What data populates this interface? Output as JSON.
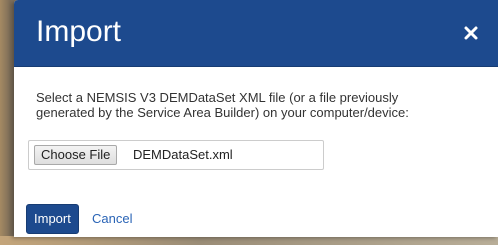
{
  "dialog": {
    "title": "Import",
    "close_icon": "close-icon",
    "instructions_line1": "Select a NEMSIS V3 DEMDataSet XML file (or a file previously",
    "instructions_line2": "generated by the Service Area Builder) on your computer/device:",
    "file_input": {
      "button_label": "Choose File",
      "selected_file": "DEMDataSet.xml"
    },
    "import_label": "Import",
    "cancel_label": "Cancel"
  },
  "colors": {
    "header_bg": "#1d4a8e",
    "primary_button": "#1d4a8e",
    "link": "#2a64b6"
  }
}
